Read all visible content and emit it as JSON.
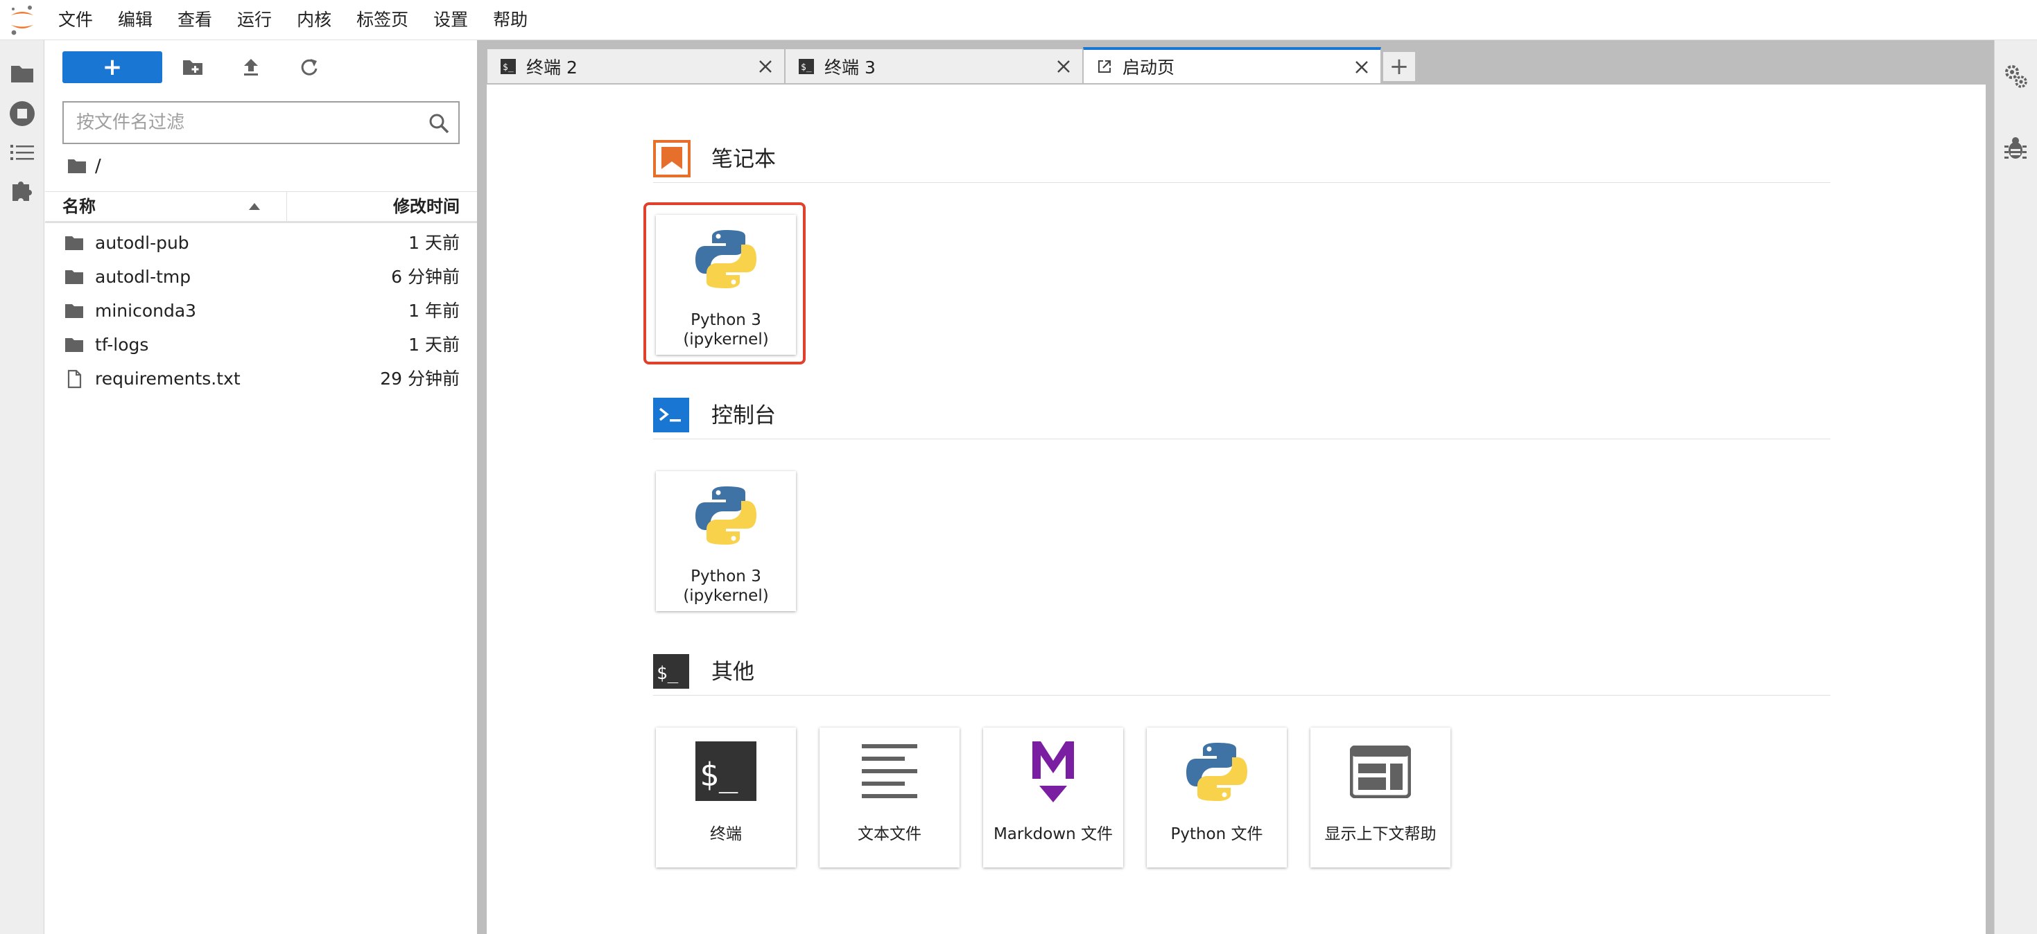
{
  "menu": [
    "文件",
    "编辑",
    "查看",
    "运行",
    "内核",
    "标签页",
    "设置",
    "帮助"
  ],
  "left_bar": {
    "icons": [
      "folder-icon",
      "running-icon",
      "table-of-contents-icon",
      "extension-icon"
    ]
  },
  "file_browser": {
    "new_button": "+",
    "filter_placeholder": "按文件名过滤",
    "breadcrumb": "/",
    "columns": {
      "name": "名称",
      "modified": "修改时间"
    },
    "files": [
      {
        "name": "autodl-pub",
        "type": "folder",
        "modified": "1 天前"
      },
      {
        "name": "autodl-tmp",
        "type": "folder",
        "modified": "6 分钟前"
      },
      {
        "name": "miniconda3",
        "type": "folder",
        "modified": "1 年前"
      },
      {
        "name": "tf-logs",
        "type": "folder",
        "modified": "1 天前"
      },
      {
        "name": "requirements.txt",
        "type": "file",
        "modified": "29 分钟前"
      }
    ]
  },
  "tabs": [
    {
      "label": "终端 2",
      "icon": "terminal-icon",
      "active": false
    },
    {
      "label": "终端 3",
      "icon": "terminal-icon",
      "active": false
    },
    {
      "label": "启动页",
      "icon": "launcher-icon",
      "active": true
    }
  ],
  "add_tab": "+",
  "launcher": {
    "notebook": {
      "title": "笔记本",
      "cards": [
        {
          "line1": "Python 3",
          "line2": "(ipykernel)"
        }
      ]
    },
    "console": {
      "title": "控制台",
      "cards": [
        {
          "line1": "Python 3",
          "line2": "(ipykernel)"
        }
      ]
    },
    "other": {
      "title": "其他",
      "cards": [
        "终端",
        "文本文件",
        "Markdown 文件",
        "Python 文件",
        "显示上下文帮助"
      ]
    }
  },
  "colors": {
    "accent": "#1976d2",
    "highlight": "#e0412c",
    "notebook_orange": "#e66f2b",
    "markdown_purple": "#7b1fa2"
  }
}
